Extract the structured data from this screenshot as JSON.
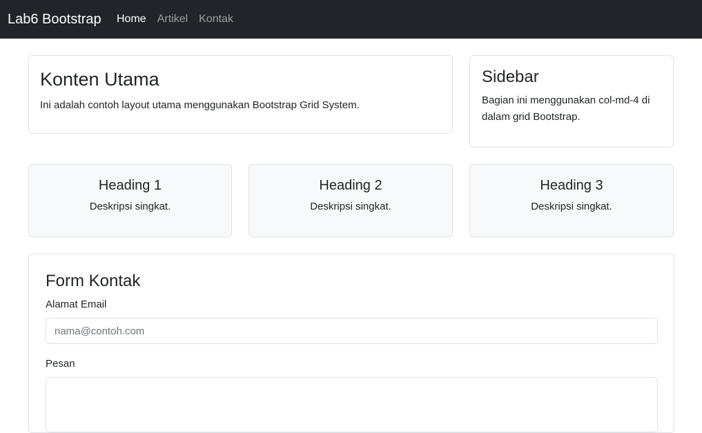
{
  "navbar": {
    "brand": "Lab6 Bootstrap",
    "links": [
      {
        "label": "Home",
        "active": true
      },
      {
        "label": "Artikel",
        "active": false
      },
      {
        "label": "Kontak",
        "active": false
      }
    ]
  },
  "main": {
    "title": "Konten Utama",
    "text": "Ini adalah contoh layout utama menggunakan Bootstrap Grid System."
  },
  "sidebar": {
    "title": "Sidebar",
    "text": "Bagian ini menggunakan col-md-4 di dalam grid Bootstrap."
  },
  "features": [
    {
      "heading": "Heading 1",
      "text": "Deskripsi singkat."
    },
    {
      "heading": "Heading 2",
      "text": "Deskripsi singkat."
    },
    {
      "heading": "Heading 3",
      "text": "Deskripsi singkat."
    }
  ],
  "form": {
    "title": "Form Kontak",
    "email_label": "Alamat Email",
    "email_placeholder": "nama@contoh.com",
    "email_value": "",
    "message_label": "Pesan",
    "message_value": ""
  },
  "colors": {
    "navbar_bg": "#212529",
    "feature_bg": "#f8f9fa",
    "border": "#dee2e6"
  }
}
